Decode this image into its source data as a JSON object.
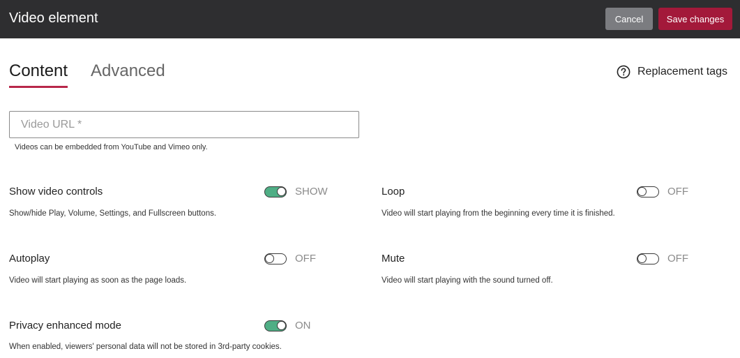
{
  "header": {
    "title": "Video element",
    "cancel_label": "Cancel",
    "save_label": "Save changes",
    "bg_color": "#2e2e30",
    "save_color": "#a3193a"
  },
  "tabs": [
    {
      "label": "Content",
      "active": true
    },
    {
      "label": "Advanced",
      "active": false
    }
  ],
  "replacement_tags": {
    "label": "Replacement tags",
    "icon": "help-circle-icon"
  },
  "video_url": {
    "placeholder": "Video URL *",
    "value": "",
    "help": "Videos can be embedded from YouTube and Vimeo only."
  },
  "settings": {
    "show_controls": {
      "title": "Show video controls",
      "description": "Show/hide Play, Volume, Settings, and Fullscreen buttons.",
      "state": "on",
      "state_label": "SHOW"
    },
    "loop": {
      "title": "Loop",
      "description": "Video will start playing from the beginning every time it is finished.",
      "state": "off",
      "state_label": "OFF"
    },
    "autoplay": {
      "title": "Autoplay",
      "description": "Video will start playing as soon as the page loads.",
      "state": "off",
      "state_label": "OFF"
    },
    "mute": {
      "title": "Mute",
      "description": "Video will start playing with the sound turned off.",
      "state": "off",
      "state_label": "OFF"
    },
    "privacy": {
      "title": "Privacy enhanced mode",
      "description": "When enabled, viewers' personal data will not be stored in 3rd-party cookies.",
      "state": "on",
      "state_label": "ON"
    }
  },
  "colors": {
    "toggle_on": "#4fae85",
    "tab_accent": "#b8274a"
  }
}
